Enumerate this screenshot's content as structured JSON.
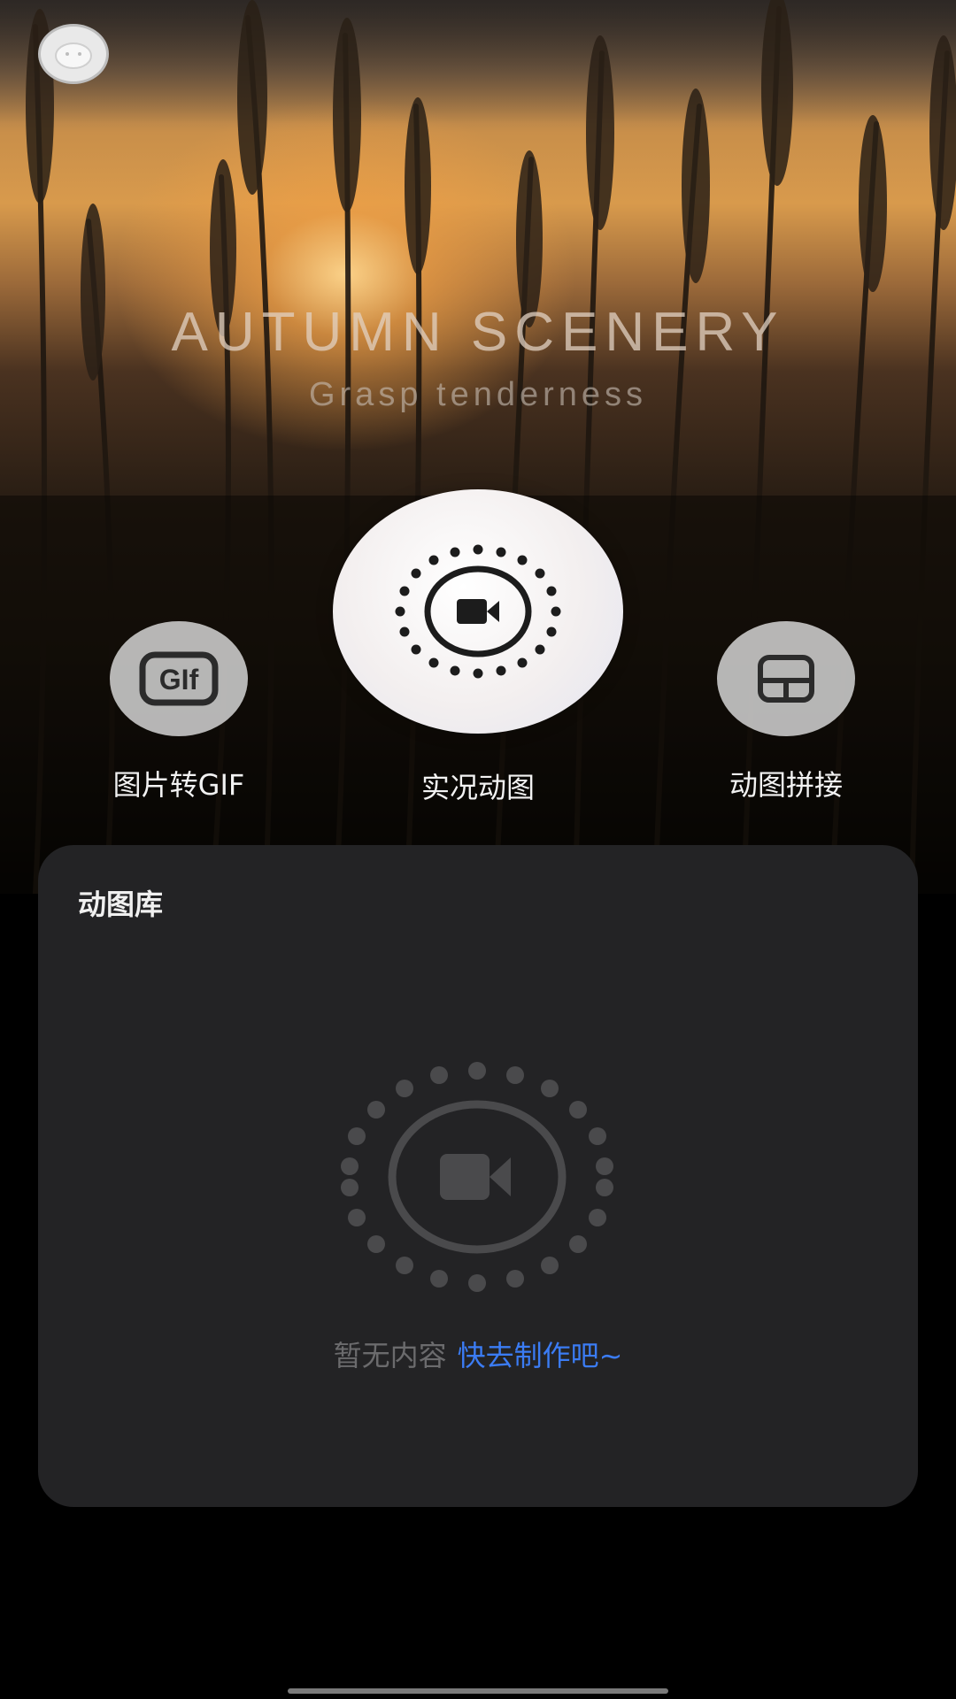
{
  "hero": {
    "title": "AUTUMN SCENERY",
    "subtitle": "Grasp tenderness"
  },
  "actions": [
    {
      "label": "图片转GIF",
      "icon": "gif-icon"
    },
    {
      "label": "实况动图",
      "icon": "live-video-icon"
    },
    {
      "label": "动图拼接",
      "icon": "grid-layout-icon"
    }
  ],
  "gallery": {
    "title": "动图库",
    "empty_text": "暂无内容",
    "empty_link": "快去制作吧~"
  },
  "colors": {
    "accent": "#3b7cf4",
    "card_bg": "#232325",
    "page_bg": "#000000"
  }
}
